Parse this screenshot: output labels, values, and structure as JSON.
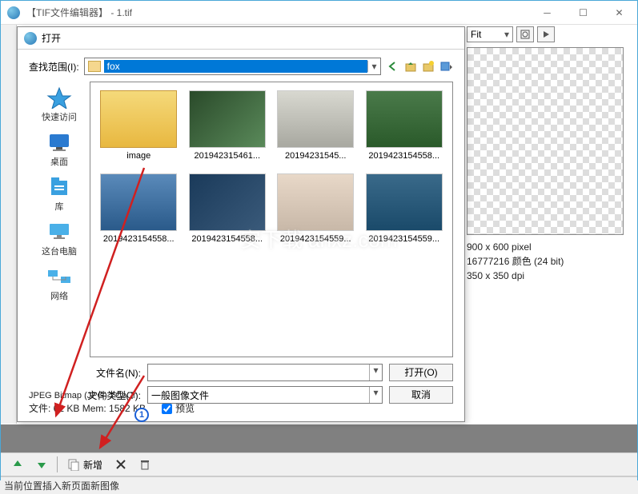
{
  "main_window": {
    "title": "【TIF文件编辑器】 - 1.tif"
  },
  "dialog": {
    "title": "打开",
    "look_in_label": "查找范围(I):",
    "folder_name": "fox",
    "places": [
      {
        "name": "quick-access",
        "label": "快速访问"
      },
      {
        "name": "desktop",
        "label": "桌面"
      },
      {
        "name": "library",
        "label": "库"
      },
      {
        "name": "this-pc",
        "label": "这台电脑"
      },
      {
        "name": "network",
        "label": "网络"
      }
    ],
    "files": [
      {
        "name": "image",
        "caption": "image",
        "type": "folder"
      },
      {
        "name": "file2",
        "caption": "201942315461..."
      },
      {
        "name": "file3",
        "caption": "20194231545..."
      },
      {
        "name": "file4",
        "caption": "2019423154558..."
      },
      {
        "name": "file5",
        "caption": "2019423154558..."
      },
      {
        "name": "file6",
        "caption": "2019423154558..."
      },
      {
        "name": "file7",
        "caption": "2019423154559..."
      },
      {
        "name": "file8",
        "caption": "2019423154559..."
      }
    ],
    "filename_label": "文件名(N):",
    "filename_value": "",
    "filetype_label": "文件类型(T):",
    "filetype_value": "一般图像文件",
    "open_btn": "打开(O)",
    "cancel_btn": "取消",
    "footer_format": "JPEG Bitmap (JPG) YCbCr",
    "footer_mem": "文件: 62 KB   Mem: 1582 KB",
    "preview_label": "预览"
  },
  "right_panel": {
    "zoom": "Fit",
    "info1": "900 x 600 pixel",
    "info2": "16777216 颜色 (24 bit)",
    "info3": "350 x 350 dpi"
  },
  "toolbar": {
    "new_label": "新增"
  },
  "status": "当前位置插入新页面新图像",
  "annotation": {
    "badge": "1"
  },
  "watermark": "安下载 anxz.com"
}
